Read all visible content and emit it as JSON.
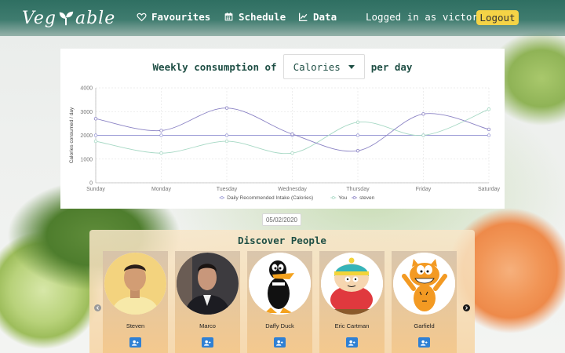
{
  "header": {
    "logo_text_a": "Veg",
    "logo_text_b": "able",
    "nav": [
      {
        "label": "Favourites",
        "icon": "heart-icon"
      },
      {
        "label": "Schedule",
        "icon": "calendar-icon"
      },
      {
        "label": "Data",
        "icon": "line-chart-icon"
      }
    ],
    "logged_in_text": "Logged in as victor",
    "logout_label": "Logout"
  },
  "chart_section": {
    "title_prefix": "Weekly consumption of",
    "selected_metric": "Calories",
    "title_suffix": "per day"
  },
  "chart_data": {
    "type": "line",
    "categories": [
      "Sunday",
      "Monday",
      "Tuesday",
      "Wednesday",
      "Thursday",
      "Friday",
      "Saturday"
    ],
    "ylabel": "Calories consumed / day",
    "xlabel": "",
    "ylim": [
      0,
      4000
    ],
    "yticks": [
      "0",
      "1000",
      "2000",
      "3000",
      "4000"
    ],
    "grid": true,
    "legend_position": "bottom",
    "series": [
      {
        "name": "Daily Recommended Intake (Calories)",
        "color": "#9b9bd6",
        "values": [
          2000,
          2000,
          2000,
          2000,
          2000,
          2000,
          2000
        ]
      },
      {
        "name": "You",
        "color": "#a6d8c4",
        "values": [
          1750,
          1250,
          1750,
          1250,
          2550,
          2000,
          3100
        ]
      },
      {
        "name": "steven",
        "color": "#8a82c4",
        "values": [
          2700,
          2200,
          3150,
          2050,
          1350,
          2900,
          2250
        ]
      }
    ]
  },
  "date_label": "05/02/2020",
  "discover": {
    "title": "Discover People",
    "people": [
      {
        "name": "Steven",
        "avatar": "man-yellow-shirt-avatar"
      },
      {
        "name": "Marco",
        "avatar": "man-suit-avatar"
      },
      {
        "name": "Daffy Duck",
        "avatar": "daffy-duck-avatar"
      },
      {
        "name": "Eric Cartman",
        "avatar": "eric-cartman-avatar"
      },
      {
        "name": "Garfield",
        "avatar": "garfield-avatar"
      }
    ]
  },
  "colors": {
    "accent_teal": "#1f4f45",
    "logout_yellow": "#f5d346",
    "add_friend_blue": "#2f80d4"
  }
}
